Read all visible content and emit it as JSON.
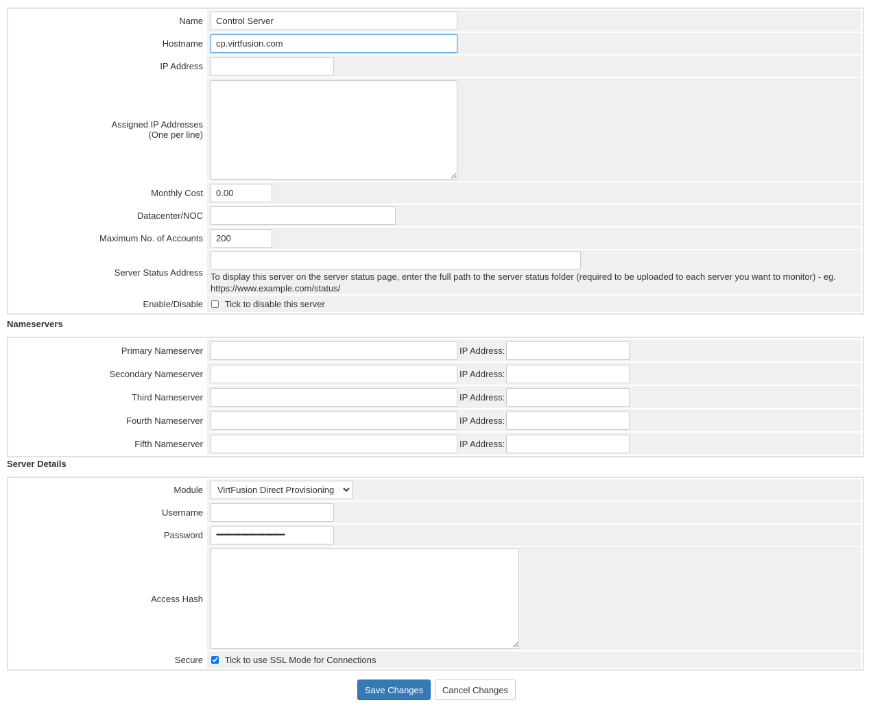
{
  "general": {
    "name_label": "Name",
    "name_value": "Control Server",
    "hostname_label": "Hostname",
    "hostname_value": "cp.virtfusion.com",
    "ip_label": "IP Address",
    "ip_value": "",
    "assigned_ips_label_line1": "Assigned IP Addresses",
    "assigned_ips_label_line2": "(One per line)",
    "assigned_ips_value": "",
    "monthly_cost_label": "Monthly Cost",
    "monthly_cost_value": "0.00",
    "datacenter_label": "Datacenter/NOC",
    "datacenter_value": "",
    "max_accounts_label": "Maximum No. of Accounts",
    "max_accounts_value": "200",
    "status_address_label": "Server Status Address",
    "status_address_value": "",
    "status_address_help": "To display this server on the server status page, enter the full path to the server status folder (required to be uploaded to each server you want to monitor) - eg. https://www.example.com/status/",
    "enable_label": "Enable/Disable",
    "disable_checkbox_label": "Tick to disable this server",
    "disable_checked": false
  },
  "nameservers": {
    "section_title": "Nameservers",
    "ip_label": "IP Address:",
    "items": [
      {
        "label": "Primary Nameserver",
        "value": "",
        "ip": ""
      },
      {
        "label": "Secondary Nameserver",
        "value": "",
        "ip": ""
      },
      {
        "label": "Third Nameserver",
        "value": "",
        "ip": ""
      },
      {
        "label": "Fourth Nameserver",
        "value": "",
        "ip": ""
      },
      {
        "label": "Fifth Nameserver",
        "value": "",
        "ip": ""
      }
    ]
  },
  "server_details": {
    "section_title": "Server Details",
    "module_label": "Module",
    "module_value": "VirtFusion Direct Provisioning",
    "username_label": "Username",
    "username_value": "",
    "password_label": "Password",
    "password_value": "••••••••••••••••••••••••••••••••••••••••",
    "access_hash_label": "Access Hash",
    "access_hash_value": "",
    "secure_label": "Secure",
    "ssl_checkbox_label": "Tick to use SSL Mode for Connections",
    "ssl_checked": true
  },
  "actions": {
    "save_label": "Save Changes",
    "cancel_label": "Cancel Changes"
  },
  "colors": {
    "primary_button": "#337ab7",
    "field_area_bg": "#f0f0f0",
    "focus_border": "#66afe9"
  }
}
